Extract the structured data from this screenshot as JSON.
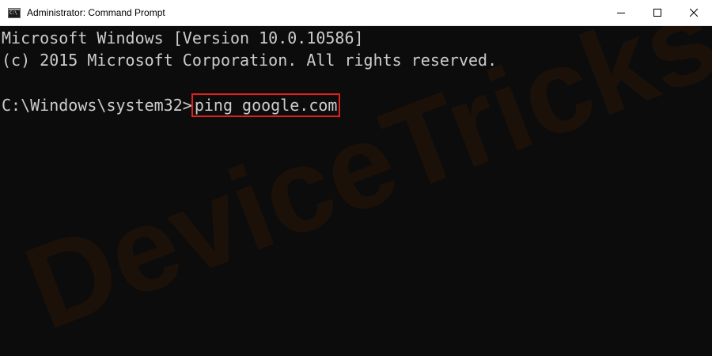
{
  "window": {
    "title": "Administrator: Command Prompt",
    "icon_text": "C:\\",
    "controls": {
      "minimize_icon": "minimize-icon",
      "maximize_icon": "maximize-icon",
      "close_icon": "close-icon"
    }
  },
  "console": {
    "lines": [
      "Microsoft Windows [Version 10.0.10586]",
      "(c) 2015 Microsoft Corporation. All rights reserved."
    ],
    "prompt": "C:\\Windows\\system32>",
    "command": "ping google.com"
  },
  "watermark": {
    "text": "DeviceTricks"
  },
  "colors": {
    "console_bg": "#0c0c0c",
    "console_text": "#cccccc",
    "highlight_border": "#e0201c",
    "watermark": "#2a1608"
  }
}
